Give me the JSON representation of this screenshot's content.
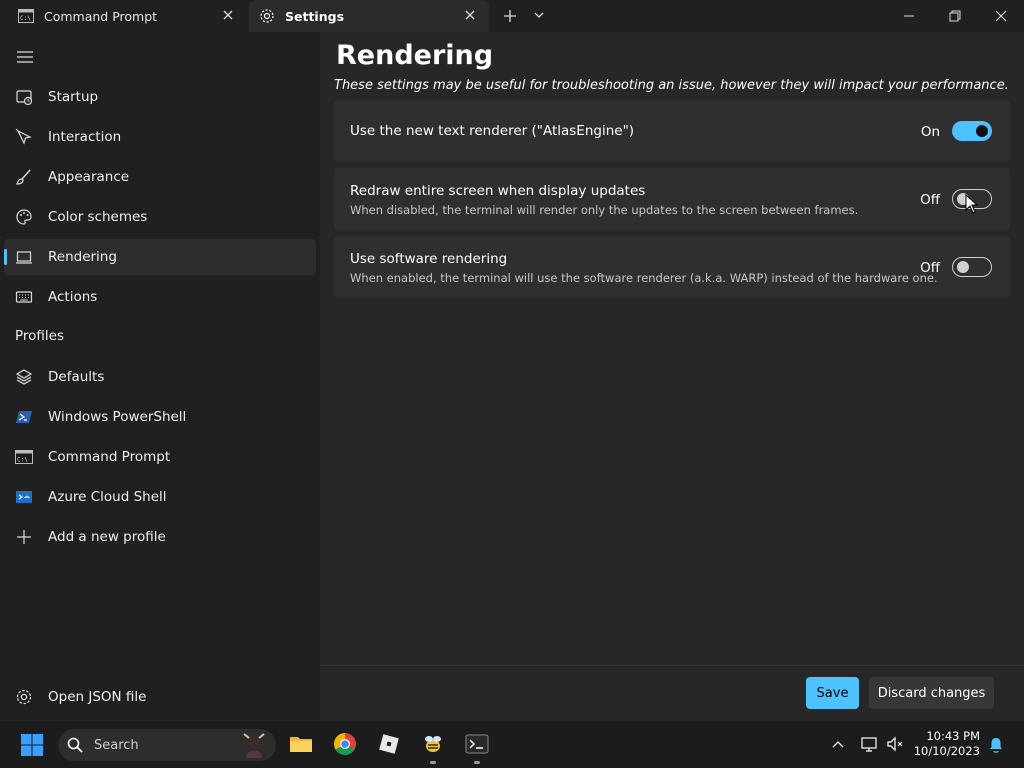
{
  "tabs": {
    "command_prompt": "Command Prompt",
    "settings": "Settings"
  },
  "sidebar": {
    "items": [
      {
        "label": "Startup",
        "icon": "startup-icon"
      },
      {
        "label": "Interaction",
        "icon": "interaction-icon"
      },
      {
        "label": "Appearance",
        "icon": "brush-icon"
      },
      {
        "label": "Color schemes",
        "icon": "palette-icon"
      },
      {
        "label": "Rendering",
        "icon": "monitor-icon",
        "selected": true
      },
      {
        "label": "Actions",
        "icon": "keyboard-icon"
      }
    ],
    "profiles_heading": "Profiles",
    "profiles": [
      {
        "label": "Defaults",
        "icon": "layers-icon"
      },
      {
        "label": "Windows PowerShell",
        "icon": "powershell-icon"
      },
      {
        "label": "Command Prompt",
        "icon": "cmd-icon"
      },
      {
        "label": "Azure Cloud Shell",
        "icon": "azure-icon"
      },
      {
        "label": "Add a new profile",
        "icon": "plus-icon"
      }
    ],
    "open_json": "Open JSON file"
  },
  "main": {
    "title": "Rendering",
    "subtitle": "These settings may be useful for troubleshooting an issue, however they will impact your performance.",
    "settings": [
      {
        "title": "Use the new text renderer (\"AtlasEngine\")",
        "description": "",
        "state": "On",
        "enabled": true
      },
      {
        "title": "Redraw entire screen when display updates",
        "description": "When disabled, the terminal will render only the updates to the screen between frames.",
        "state": "Off",
        "enabled": false
      },
      {
        "title": "Use software rendering",
        "description": "When enabled, the terminal will use the software renderer (a.k.a. WARP) instead of the hardware one.",
        "state": "Off",
        "enabled": false
      }
    ],
    "save_label": "Save",
    "discard_label": "Discard changes"
  },
  "taskbar": {
    "search_placeholder": "Search",
    "time": "10:43 PM",
    "date": "10/10/2023"
  },
  "colors": {
    "accent": "#4cc2ff",
    "background": "#202020",
    "content": "#272727",
    "card": "#2f2f2f"
  }
}
